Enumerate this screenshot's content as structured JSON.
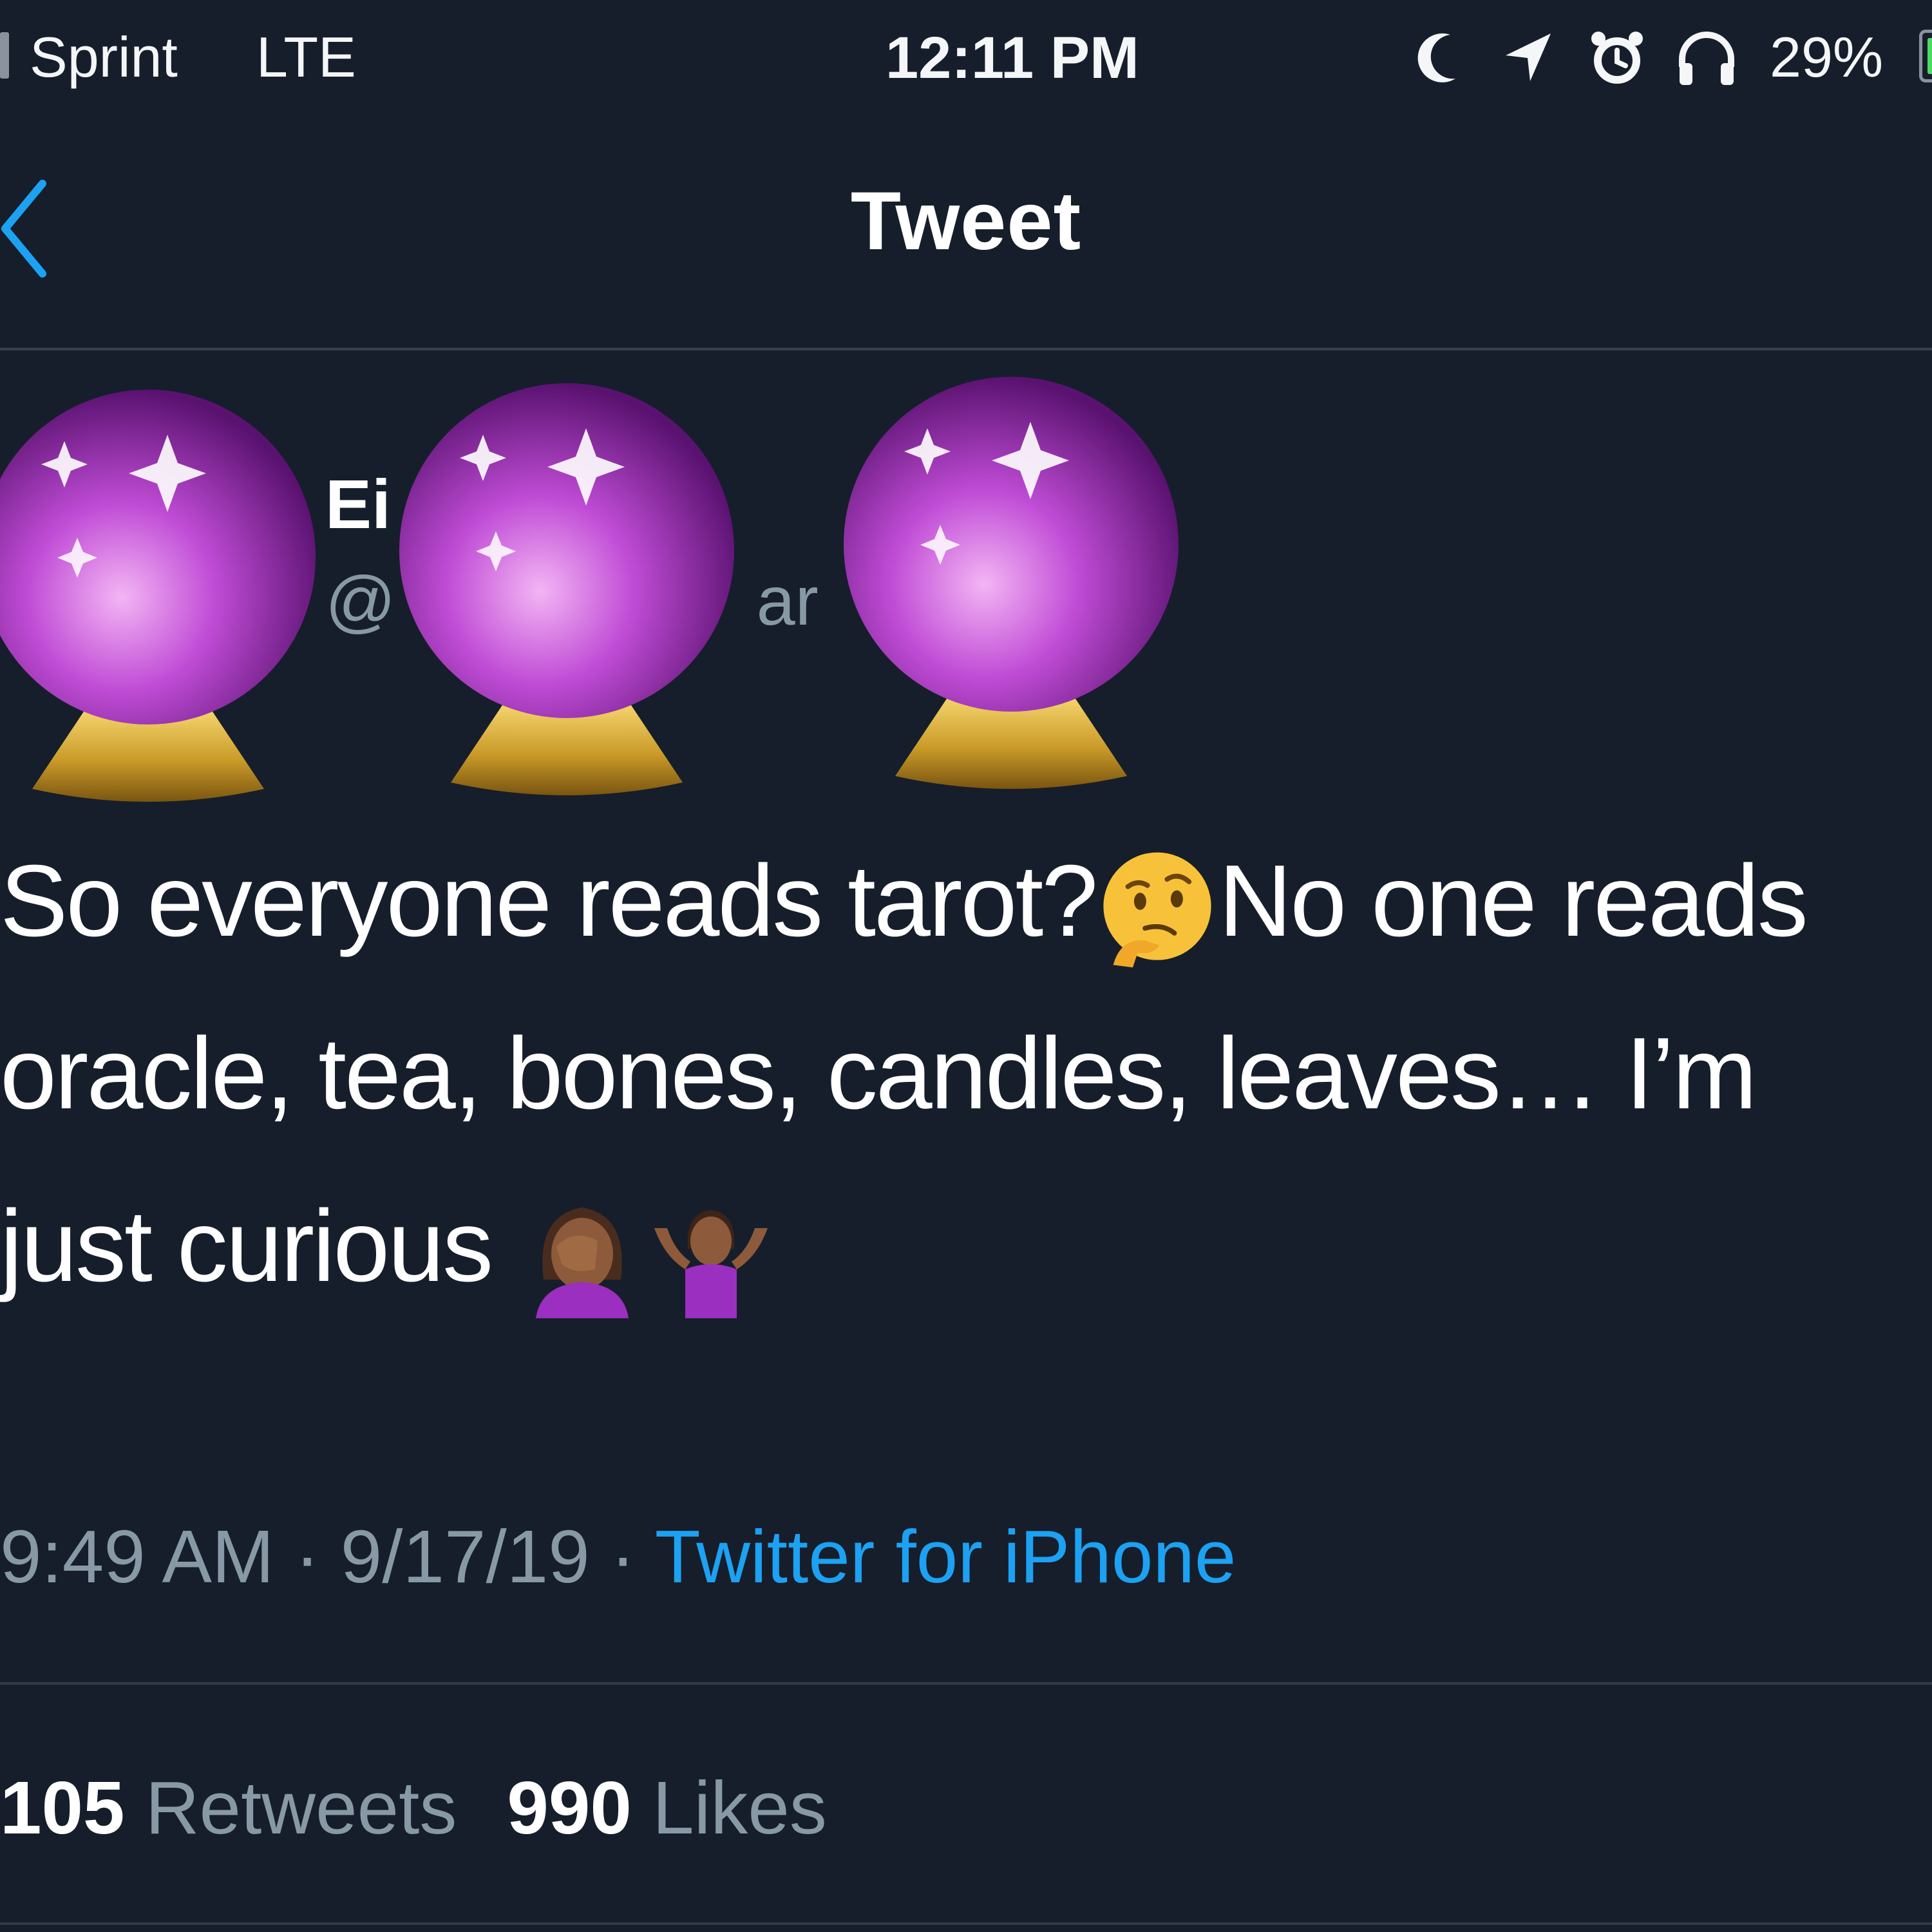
{
  "status_bar": {
    "carrier": "Sprint",
    "network": "LTE",
    "time": "12:11 PM",
    "icons": [
      "moon-icon",
      "location-arrow-icon",
      "alarm-icon",
      "headphones-icon"
    ],
    "battery_percent": "29%",
    "battery_level": 0.29
  },
  "nav": {
    "title": "Tweet",
    "back_icon": "chevron-left-icon",
    "accent_color": "#1da1f2"
  },
  "author": {
    "name": "Ei",
    "handle_start": "@",
    "handle_end": "ar",
    "overlay_emoji": [
      "crystal-ball-emoji",
      "crystal-ball-emoji",
      "crystal-ball-emoji"
    ]
  },
  "tweet": {
    "line1_a": "So everyone reads tarot?",
    "line1_emoji": "thinking-face-emoji",
    "line1_b": "No one reads",
    "line2": "oracle, tea, bones, candles, leaves… I’m",
    "line3": "just curious ",
    "line3_emojis": [
      "woman-facepalming-emoji",
      "woman-shrugging-emoji"
    ]
  },
  "meta": {
    "time": "9:49 AM",
    "separator": " · ",
    "date": "9/17/19",
    "source": "Twitter for iPhone"
  },
  "stats": {
    "retweets_count": "105",
    "retweets_label": "Retweets",
    "likes_count": "990",
    "likes_label": "Likes"
  },
  "colors": {
    "background": "#161e2b",
    "text_primary": "#ffffff",
    "text_secondary": "#8899a6",
    "link": "#1da1f2",
    "divider": "#38444d"
  }
}
